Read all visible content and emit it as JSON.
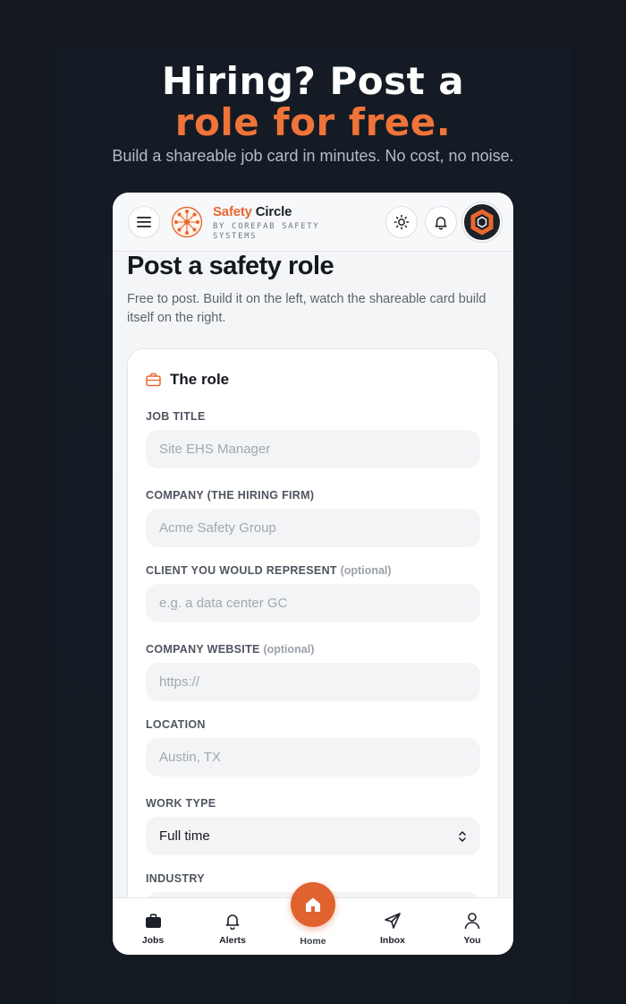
{
  "hero": {
    "line1": "Hiring? Post a",
    "line2": "role for free.",
    "subtitle": "Build a shareable job card in minutes. No cost, no noise."
  },
  "appbar": {
    "brand_primary": "Safety",
    "brand_secondary": " Circle",
    "brand_sub": "BY COREFAB SAFETY SYSTEMS",
    "icons": [
      "menu-icon",
      "sun-icon",
      "bell-icon",
      "hexagon-avatar"
    ]
  },
  "page": {
    "title": "Post a safety role",
    "description": "Free to post. Build it on the left, watch the shareable card build itself on the right."
  },
  "section": {
    "icon": "briefcase-icon",
    "title": "The role"
  },
  "fields": [
    {
      "label": "JOB TITLE",
      "optional": "",
      "placeholder": "Site EHS Manager"
    },
    {
      "label": "COMPANY (THE HIRING FIRM)",
      "optional": "",
      "placeholder": "Acme Safety Group"
    },
    {
      "label": "CLIENT YOU WOULD REPRESENT",
      "optional": "(optional)",
      "placeholder": "e.g. a data center GC"
    },
    {
      "label": "COMPANY WEBSITE",
      "optional": "(optional)",
      "placeholder": "https://"
    },
    {
      "label": "LOCATION",
      "optional": "",
      "placeholder": "Austin, TX"
    },
    {
      "label": "WORK TYPE",
      "optional": "",
      "value": "Full time"
    },
    {
      "label": "INDUSTRY",
      "optional": ""
    }
  ],
  "tabbar": {
    "jobs": "Jobs",
    "alerts": "Alerts",
    "home": "Home",
    "inbox": "Inbox",
    "you": "You"
  },
  "colors": {
    "accent": "#e8672f",
    "background": "#121720",
    "card": "#ffffff",
    "field": "#f3f4f6"
  }
}
